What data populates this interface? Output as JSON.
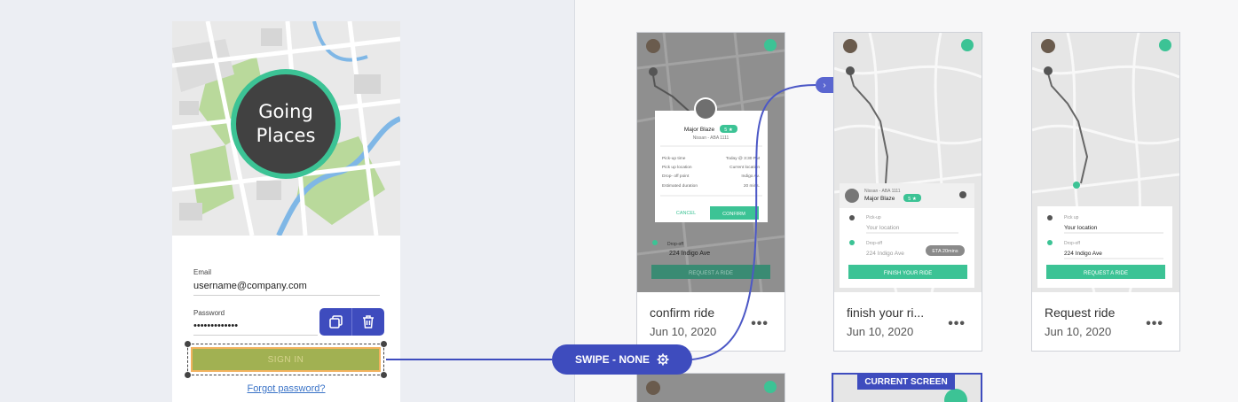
{
  "login": {
    "logo_line1": "Going",
    "logo_line2": "Places",
    "email_label": "Email",
    "email_value": "username@company.com",
    "password_label": "Password",
    "password_value": "•••••••••••••",
    "signin_label": "SIGN IN",
    "forgot_label": "Forgot password?"
  },
  "toolbar": {
    "duplicate_icon": "copy-icon",
    "delete_icon": "trash-icon"
  },
  "interaction": {
    "label": "SWIPE - NONE",
    "icon": "gear-icon"
  },
  "current_screen_label": "CURRENT SCREEN",
  "screens": [
    {
      "title": "confirm ride",
      "date": "Jun 10, 2020",
      "more": "•••",
      "popup": {
        "driver_name": "Major Blaze",
        "rating": "5 ★",
        "vehicle": "Nissan - ABA 1111",
        "rows": [
          {
            "label": "Pick-up time",
            "value": "Today @ 3:30 PM"
          },
          {
            "label": "Pick up location",
            "value": "Current location"
          },
          {
            "label": "Drop- off point",
            "value": "Indigo Av."
          },
          {
            "label": "Estimated duration",
            "value": "20 mins."
          }
        ],
        "cancel": "CANCEL",
        "confirm": "CONFIRM"
      },
      "dropoff_label": "Drop-off",
      "dropoff_value": "224 Indigo Ave",
      "cta": "REQUEST A RIDE"
    },
    {
      "title": "finish your ri...",
      "date": "Jun 10, 2020",
      "more": "•••",
      "vehicle": "Nissan - ABA 1111",
      "driver_name": "Major Blaze",
      "rating": "5 ★",
      "pickup_label": "Pick-up",
      "pickup_value": "Your location",
      "dropoff_label": "Drop-off",
      "dropoff_value": "224 Indigo Ave",
      "eta": "ETA 20mins",
      "cta": "FINISH YOUR RIDE"
    },
    {
      "title": "Request ride",
      "date": "Jun 10, 2020",
      "more": "•••",
      "pickup_label": "Pick up",
      "pickup_value": "Your location",
      "dropoff_label": "Drop-off",
      "dropoff_value": "224 Indigo Ave",
      "cta": "REQUEST A RIDE"
    }
  ],
  "colors": {
    "accent": "#3e4cbe",
    "brand_green": "#3cc395",
    "signin_fill": "#a1b152",
    "selection_outline": "#f2b25e"
  }
}
